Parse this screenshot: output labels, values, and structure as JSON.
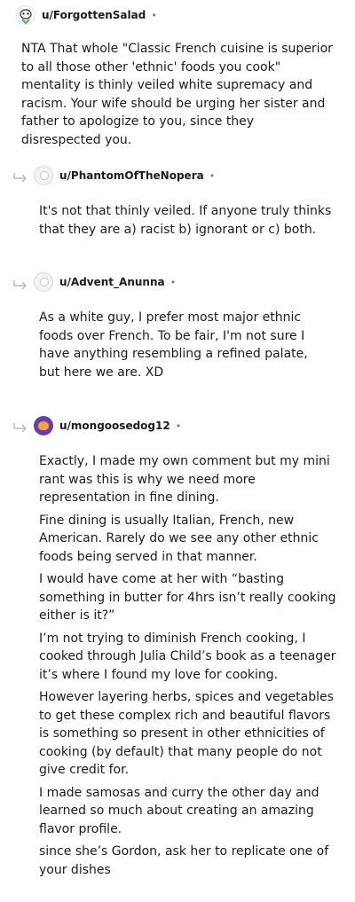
{
  "comments": [
    {
      "username": "u/ForgottenSalad",
      "avatar": "snoo-avatar",
      "body": [
        "NTA That whole \"Classic French cuisine is superior to all those other 'ethnic' foods you cook\" mentality is thinly veiled white supremacy and racism. Your wife should be urging her sister and father to apologize to you, since they disrespected you."
      ]
    },
    {
      "username": "u/PhantomOfTheNopera",
      "avatar": "default-avatar",
      "body": [
        "It's not that thinly veiled. If anyone truly thinks that they are a) racist b) ignorant or c) both."
      ]
    },
    {
      "username": "u/Advent_Anunna",
      "avatar": "default-avatar",
      "body": [
        "As a white guy, I prefer most major ethnic foods over French. To be fair, I'm not sure I have anything resembling a refined palate, but here we are. XD"
      ]
    },
    {
      "username": "u/mongoosedog12",
      "avatar": "purple-avatar",
      "body": [
        "Exactly, I made my own comment but my mini rant was this is why we need more representation in fine dining.",
        "Fine dining is usually Italian, French, new American. Rarely do we see any other ethnic foods being served in that manner.",
        "I would have come at her with “basting something in butter for 4hrs isn’t really cooking either is it?”",
        "I’m not trying to diminish French cooking, I cooked through Julia Child’s book as a teenager it’s where I found my love for cooking.",
        "However layering herbs, spices and vegetables to get these complex rich and beautiful flavors is something so present in other ethnicities of cooking (by default) that many people do not give credit for.",
        "I made samosas and curry the other day and learned so much about creating an amazing flavor profile.",
        "since she’s Gordon, ask her to replicate one of your dishes"
      ]
    }
  ],
  "separator": "•"
}
